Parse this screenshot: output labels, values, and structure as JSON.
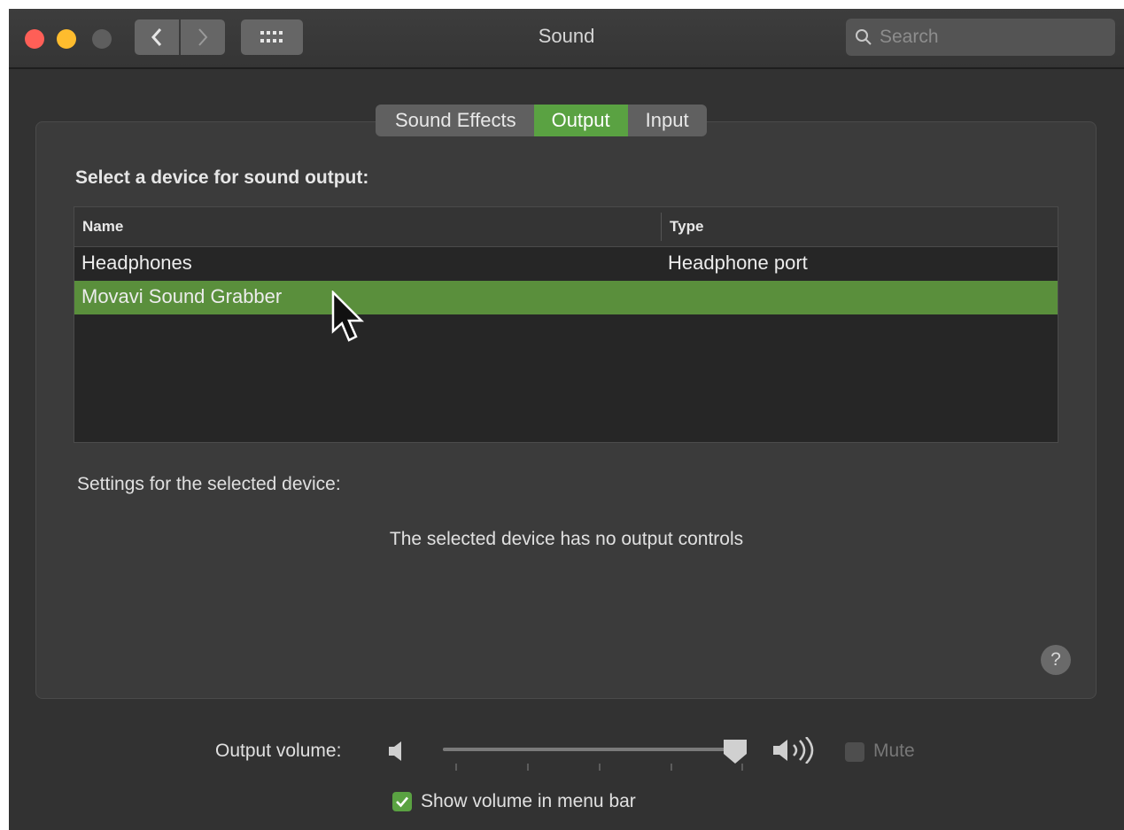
{
  "window": {
    "title": "Sound"
  },
  "toolbar": {
    "back_icon": "chevron-left-icon",
    "forward_icon": "chevron-right-icon",
    "grid_icon": "grid-icon",
    "search_placeholder": "Search"
  },
  "tabs": [
    {
      "label": "Sound Effects",
      "active": false
    },
    {
      "label": "Output",
      "active": true
    },
    {
      "label": "Input",
      "active": false
    }
  ],
  "output": {
    "section_title": "Select a device for sound output:",
    "columns": {
      "name": "Name",
      "type": "Type"
    },
    "devices": [
      {
        "name": "Headphones",
        "type": "Headphone port",
        "selected": false
      },
      {
        "name": "Movavi Sound Grabber",
        "type": "",
        "selected": true
      }
    ],
    "settings_label": "Settings for the selected device:",
    "no_controls_text": "The selected device has no output controls",
    "help_label": "?"
  },
  "volume": {
    "label": "Output volume:",
    "level_fraction": 1.0,
    "mute_label": "Mute",
    "mute_checked": false
  },
  "menu_bar": {
    "label": "Show volume in menu bar",
    "checked": true
  },
  "colors": {
    "accent_green": "#5aa242",
    "selected_row": "#5a8f3c",
    "close": "#fe5f57",
    "minimize": "#febc2e"
  }
}
